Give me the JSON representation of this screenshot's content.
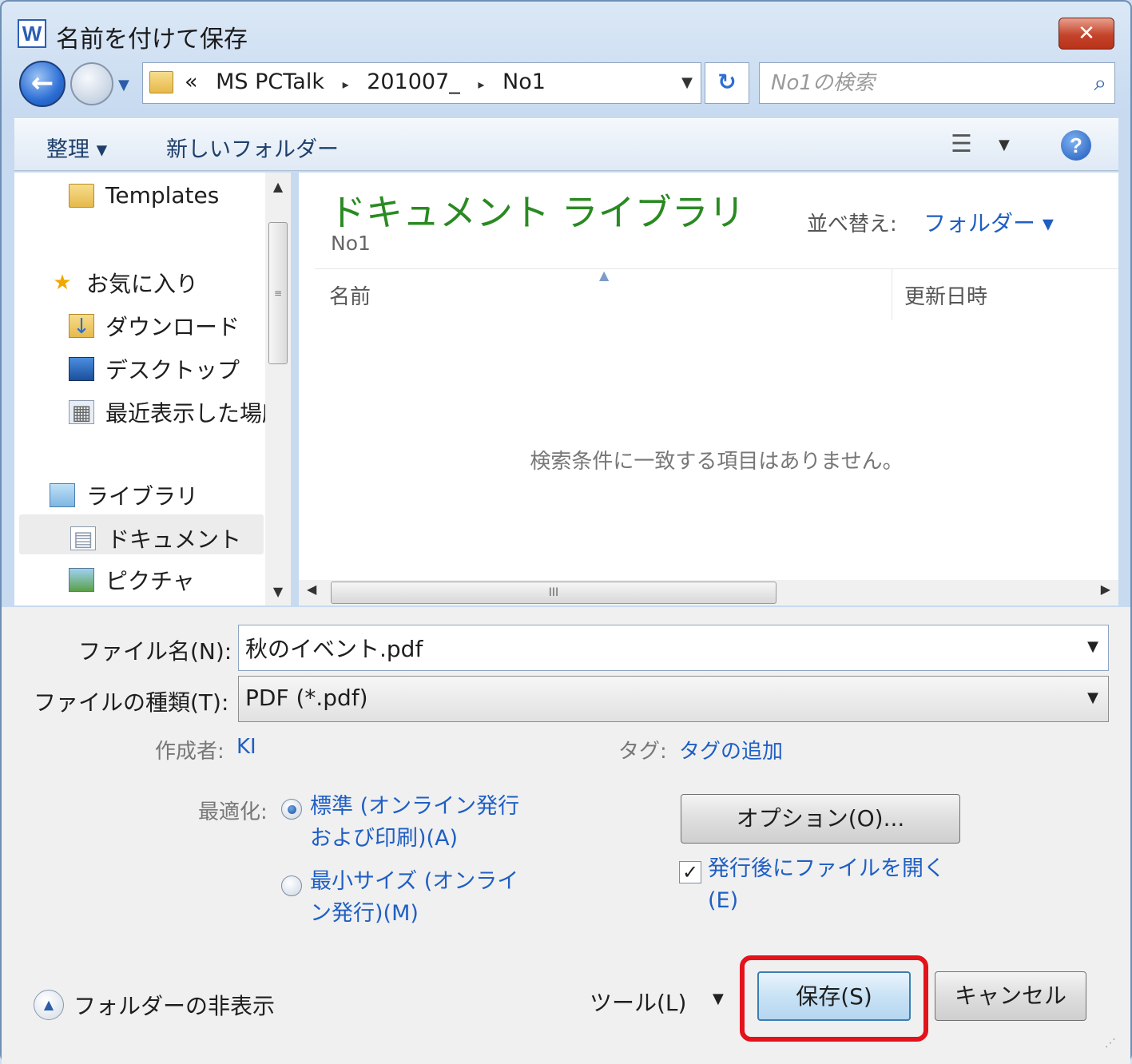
{
  "window": {
    "app_icon": "W",
    "title": "名前を付けて保存",
    "close_glyph": "✕"
  },
  "nav": {
    "back_glyph": "←",
    "crumb_prefix": "«",
    "breadcrumbs": [
      "MS PCTalk",
      "201007_",
      "No1"
    ],
    "separator": "▸",
    "refresh_glyph": "↻",
    "search_placeholder": "No1の検索"
  },
  "toolbar": {
    "organize": "整理 ▾",
    "new_folder": "新しいフォルダー"
  },
  "sidebar": {
    "templates": "Templates",
    "favorites": "お気に入り",
    "downloads": "ダウンロード",
    "desktop": "デスクトップ",
    "recent": "最近表示した場所",
    "libraries": "ライブラリ",
    "documents": "ドキュメント",
    "pictures": "ピクチャ"
  },
  "filelist": {
    "library_title": "ドキュメント ライブラリ",
    "library_subtitle": "No1",
    "sort_label": "並べ替え:",
    "sort_value": "フォルダー ▾",
    "col_name": "名前",
    "col_date": "更新日時",
    "empty_message": "検索条件に一致する項目はありません。",
    "hscroll_grip": "III"
  },
  "form": {
    "filename_label": "ファイル名(N):",
    "filename_value": "秋のイベント.pdf",
    "filetype_label": "ファイルの種類(T):",
    "filetype_value": "PDF (*.pdf)",
    "author_label": "作成者:",
    "author_value": "KI",
    "tags_label": "タグ:",
    "tags_value": "タグの追加",
    "optimize_label": "最適化:",
    "optimize_standard": "標準 (オンライン発行および印刷)(A)",
    "optimize_minimum": "最小サイズ (オンライン発行)(M)",
    "options_button": "オプション(O)...",
    "open_after_publish": "発行後にファイルを開く(E)",
    "checkmark": "✓"
  },
  "footer": {
    "hide_folders": "フォルダーの非表示",
    "tools": "ツール(L)",
    "save": "保存(S)",
    "cancel": "キャンセル"
  },
  "colors": {
    "library_title": "#2a8a22",
    "link": "#1f5fc4",
    "highlight": "#e3121b"
  }
}
